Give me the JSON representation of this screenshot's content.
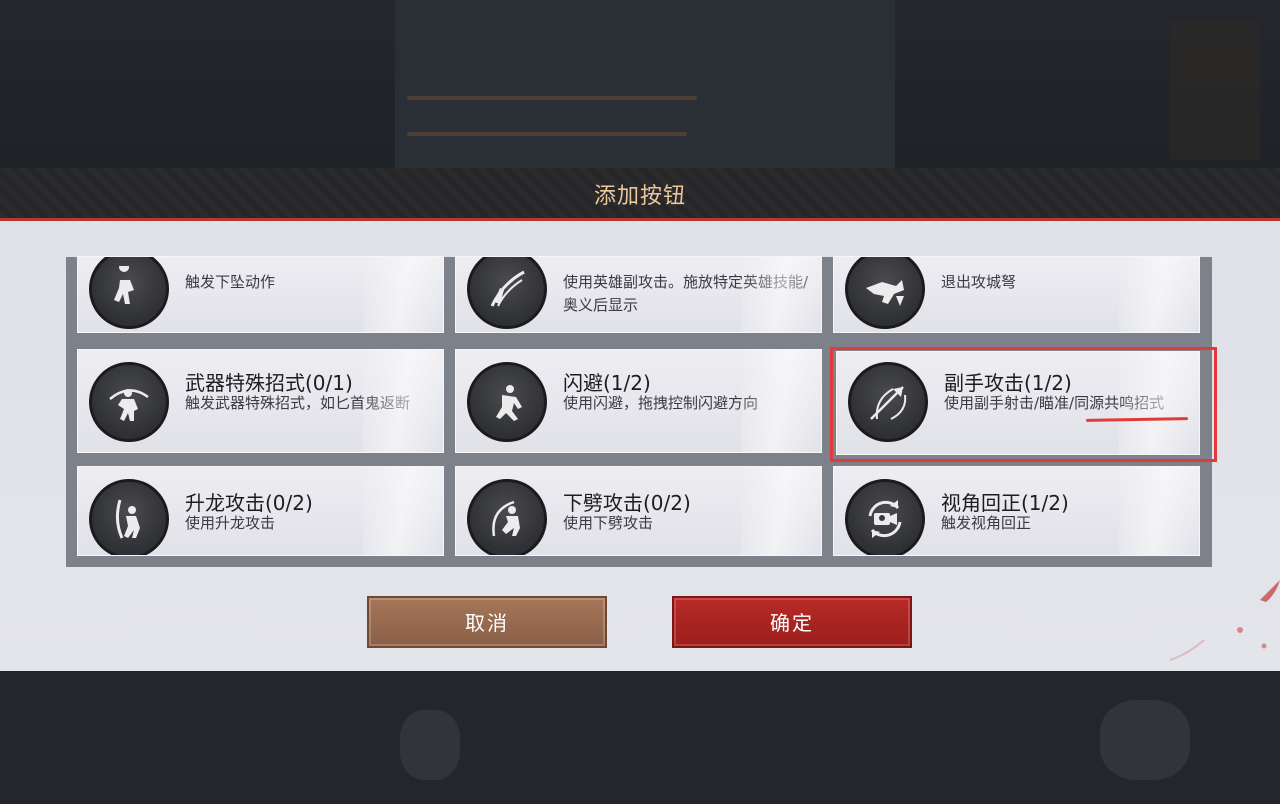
{
  "dialog": {
    "title": "添加按钮"
  },
  "cards": [
    {
      "title": "",
      "desc": "触发下坠动作",
      "icon": "falling-figure-icon"
    },
    {
      "title": "",
      "desc": "使用英雄副攻击。施放特定英雄技能/奥义后显示",
      "icon": "slash-figure-icon"
    },
    {
      "title": "",
      "desc": "退出攻城弩",
      "icon": "siege-crossbow-icon"
    },
    {
      "title": "武器特殊招式(0/1)",
      "desc": "触发武器特殊招式，如匕首鬼返断",
      "icon": "weapon-special-figure-icon"
    },
    {
      "title": "闪避(1/2)",
      "desc": "使用闪避，拖拽控制闪避方向",
      "icon": "dodge-figure-icon"
    },
    {
      "title": "副手攻击(1/2)",
      "desc": "使用副手射击/瞄准/同源共鸣招式",
      "icon": "offhand-arrow-icon"
    },
    {
      "title": "升龙攻击(0/2)",
      "desc": "使用升龙攻击",
      "icon": "rising-dragon-figure-icon"
    },
    {
      "title": "下劈攻击(0/2)",
      "desc": "使用下劈攻击",
      "icon": "down-slash-figure-icon"
    },
    {
      "title": "视角回正(1/2)",
      "desc": "触发视角回正",
      "icon": "camera-reset-icon"
    }
  ],
  "buttons": {
    "cancel": "取消",
    "confirm": "确定"
  },
  "colors": {
    "header_title": "#e9c79a",
    "accent_red": "#b3382f",
    "highlight": "#e23a3a",
    "cancel_button": "#9a6a50",
    "confirm_button": "#ab2421"
  }
}
